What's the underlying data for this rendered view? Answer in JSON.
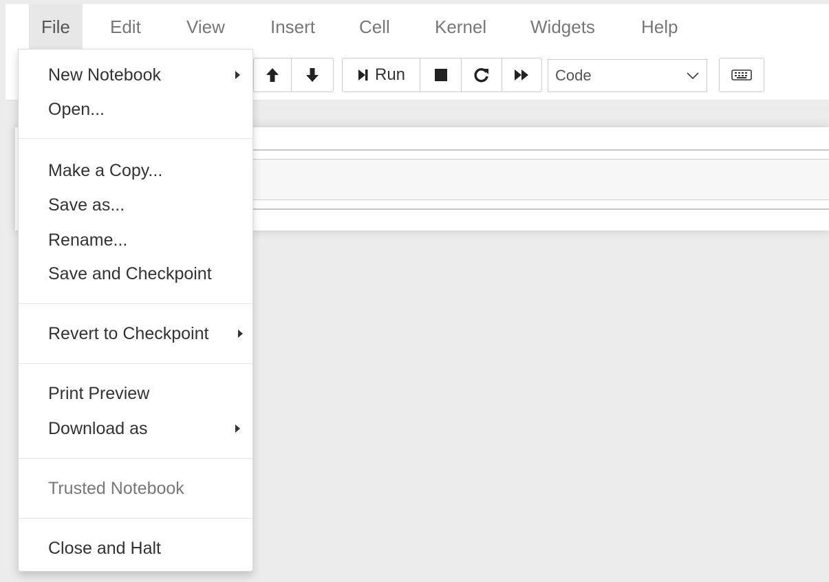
{
  "menubar": {
    "items": [
      {
        "label": "File",
        "active": true
      },
      {
        "label": "Edit"
      },
      {
        "label": "View"
      },
      {
        "label": "Insert"
      },
      {
        "label": "Cell"
      },
      {
        "label": "Kernel"
      },
      {
        "label": "Widgets"
      },
      {
        "label": "Help"
      }
    ]
  },
  "toolbar": {
    "icons": [
      "arrow-up-icon",
      "arrow-down-icon",
      "step-forward-icon",
      "stop-icon",
      "restart-icon",
      "fast-forward-icon",
      "keyboard-icon"
    ],
    "run_label": "Run",
    "cell_type": {
      "selected": "Code"
    }
  },
  "file_menu": {
    "items": {
      "new_notebook": "New Notebook",
      "open": "Open...",
      "make_copy": "Make a Copy...",
      "save_as": "Save as...",
      "rename": "Rename...",
      "save_checkpoint": "Save and Checkpoint",
      "revert_checkpoint": "Revert to Checkpoint",
      "print_preview": "Print Preview",
      "download_as": "Download as",
      "trusted_notebook": "Trusted Notebook",
      "close_halt": "Close and Halt"
    }
  },
  "colors": {
    "menu_text": "#777777",
    "active_menu_bg": "#e7e7e7",
    "page_bg": "#ececec",
    "disabled_text": "#777777"
  }
}
